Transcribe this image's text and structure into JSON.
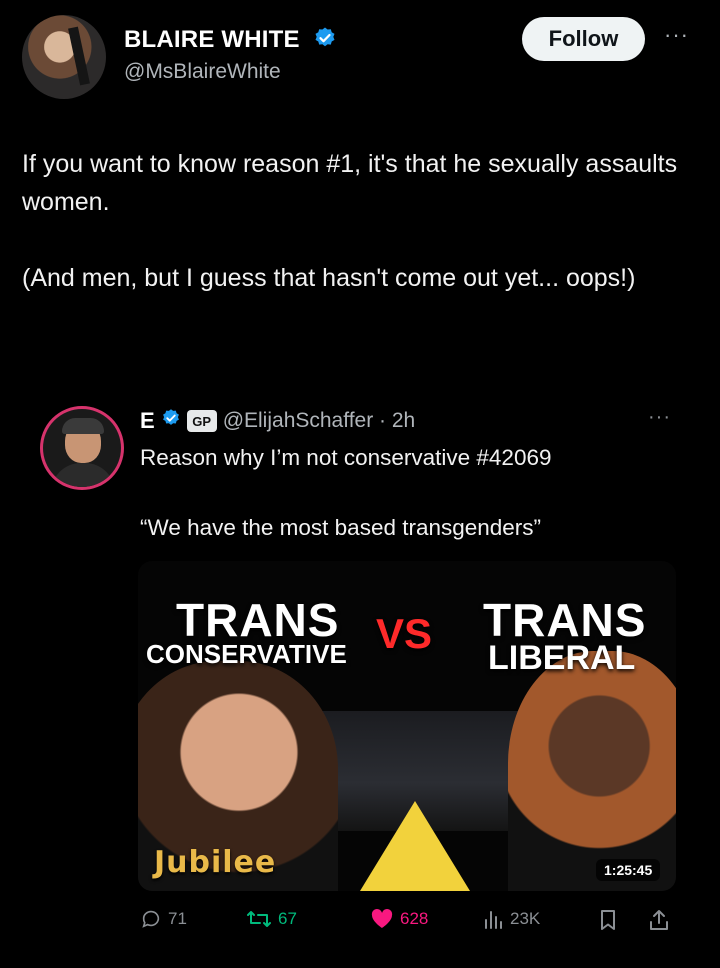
{
  "author": {
    "display_name": "BLAIRE WHITE",
    "handle": "@MsBlaireWhite",
    "follow_label": "Follow",
    "more": "···"
  },
  "tweet": {
    "line1": "If you want to know reason #1, it's that he sexually assaults women.",
    "line2": "(And men, but I guess that hasn't come out yet... oops!)"
  },
  "quoted": {
    "display_name": "E",
    "badge": "GP",
    "handle_time": "@ElijahSchaffer · 2h",
    "more": "···",
    "text1": "Reason why I’m not conservative #42069",
    "text2": "“We have the most based transgenders”",
    "thumbnail": {
      "left_top": "TRANS",
      "left_bottom": "CONSERVATIVE",
      "vs": "VS",
      "right_top": "TRANS",
      "right_bottom": "LIBERAL",
      "brand": "Jubilee",
      "duration": "1:25:45"
    }
  },
  "actions": {
    "replies": "71",
    "reposts": "67",
    "likes": "628",
    "views": "23K"
  },
  "colors": {
    "verified": "#1d9bf0",
    "repost": "#00ba7c",
    "like": "#f91880",
    "vs": "#ff2a2a"
  }
}
